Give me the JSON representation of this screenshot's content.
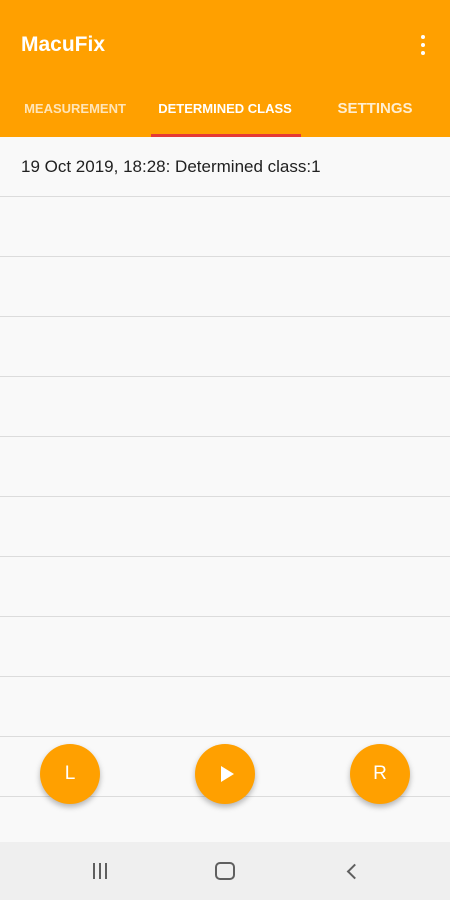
{
  "app": {
    "title": "MacuFix"
  },
  "tabs": [
    {
      "label": "MEASUREMENT"
    },
    {
      "label": "DETERMINED CLASS"
    },
    {
      "label": "SETTINGS"
    }
  ],
  "list": {
    "items": [
      {
        "text": "19 Oct 2019, 18:28: Determined class:1"
      }
    ]
  },
  "fabs": {
    "left_label": "L",
    "play_icon": "play-icon",
    "right_label": "R"
  },
  "colors": {
    "accent": "#FFA000",
    "tab_indicator": "#e53935"
  }
}
